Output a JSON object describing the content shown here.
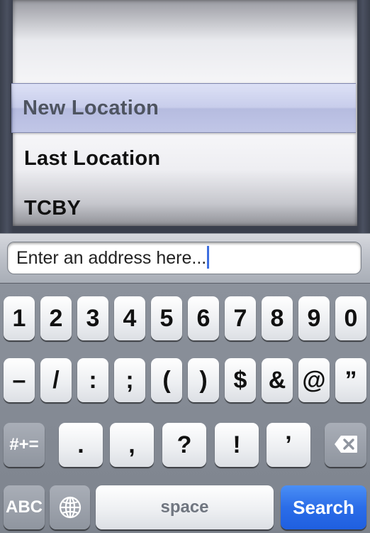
{
  "picker": {
    "options": [
      "New Location",
      "Last Location",
      "TCBY"
    ],
    "selected": "New Location"
  },
  "address": {
    "value": "Enter an address here..."
  },
  "keyboard": {
    "row1": [
      "1",
      "2",
      "3",
      "4",
      "5",
      "6",
      "7",
      "8",
      "9",
      "0"
    ],
    "row2": [
      "–",
      "/",
      ":",
      ";",
      "(",
      ")",
      "$",
      "&",
      "@",
      "”"
    ],
    "row3": {
      "shift_label": "#+=",
      "keys": [
        ".",
        ",",
        "?",
        "!",
        "’"
      ]
    },
    "row4": {
      "mode_label": "ABC",
      "space_label": "space",
      "search_label": "Search"
    }
  },
  "colors": {
    "search_key": "#2b6de8",
    "caret": "#3d6fe0"
  },
  "icons": [
    "globe-icon",
    "backspace-icon"
  ]
}
